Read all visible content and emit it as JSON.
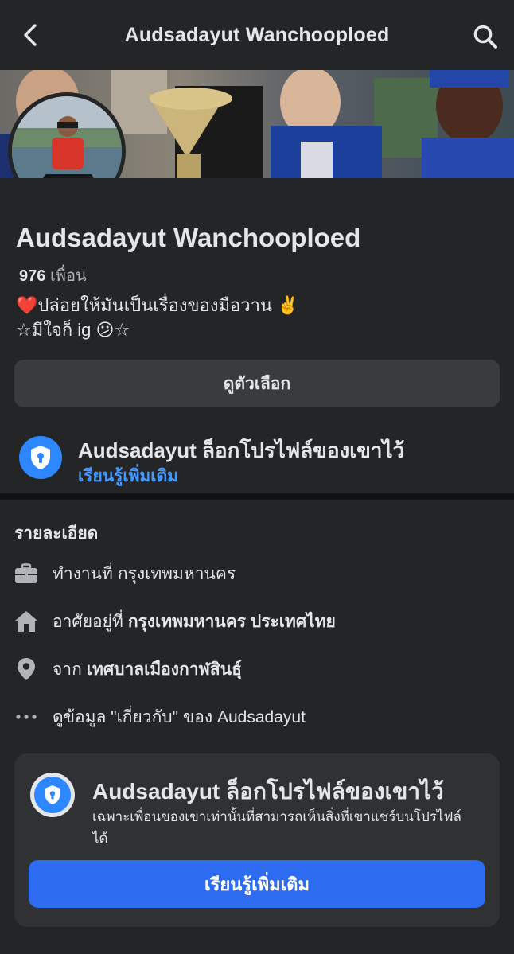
{
  "header": {
    "title": "Audsadayut Wanchooploed",
    "back_icon": "chevron-left-icon",
    "search_icon": "search-icon"
  },
  "profile": {
    "name": "Audsadayut Wanchooploed",
    "friends_count": "976",
    "friends_label": "เพื่อน",
    "bio_line1": "❤️ปล่อยให้มันเป็นเรื่องของมือวาน ✌️",
    "bio_line2": "☆มีใจก็ ig 😕☆",
    "options_label": "ดูตัวเลือก",
    "lock_title": "Audsadayut ล็อกโปรไฟล์ของเขาไว้",
    "learn_more": "เรียนรู้เพิ่มเติม"
  },
  "details": {
    "title": "รายละเอียด",
    "work_prefix": "ทำงานที่",
    "work_value": "กรุงเทพมหานคร",
    "lives_prefix": "อาศัยอยู่ที่",
    "lives_value": "กรุงเทพมหานคร ประเทศไทย",
    "from_prefix": "จาก",
    "from_value": "เทศบาลเมืองกาฬสินธุ์",
    "about_link": "ดูข้อมูล \"เกี่ยวกับ\" ของ Audsadayut"
  },
  "locked_card": {
    "title": "Audsadayut ล็อกโปรไฟล์ของเขาไว้",
    "description": "เฉพาะเพื่อนของเขาเท่านั้นที่สามารถเห็นสิ่งที่เขาแชร์บนโปรไฟล์ได้",
    "button_label": "เรียนรู้เพิ่มเติม"
  },
  "colors": {
    "background": "#18191a",
    "surface": "#242526",
    "button_bg": "#3a3b3c",
    "accent_blue": "#2d88ff",
    "link_blue": "#4599ff",
    "primary_button": "#2d6cf0"
  }
}
